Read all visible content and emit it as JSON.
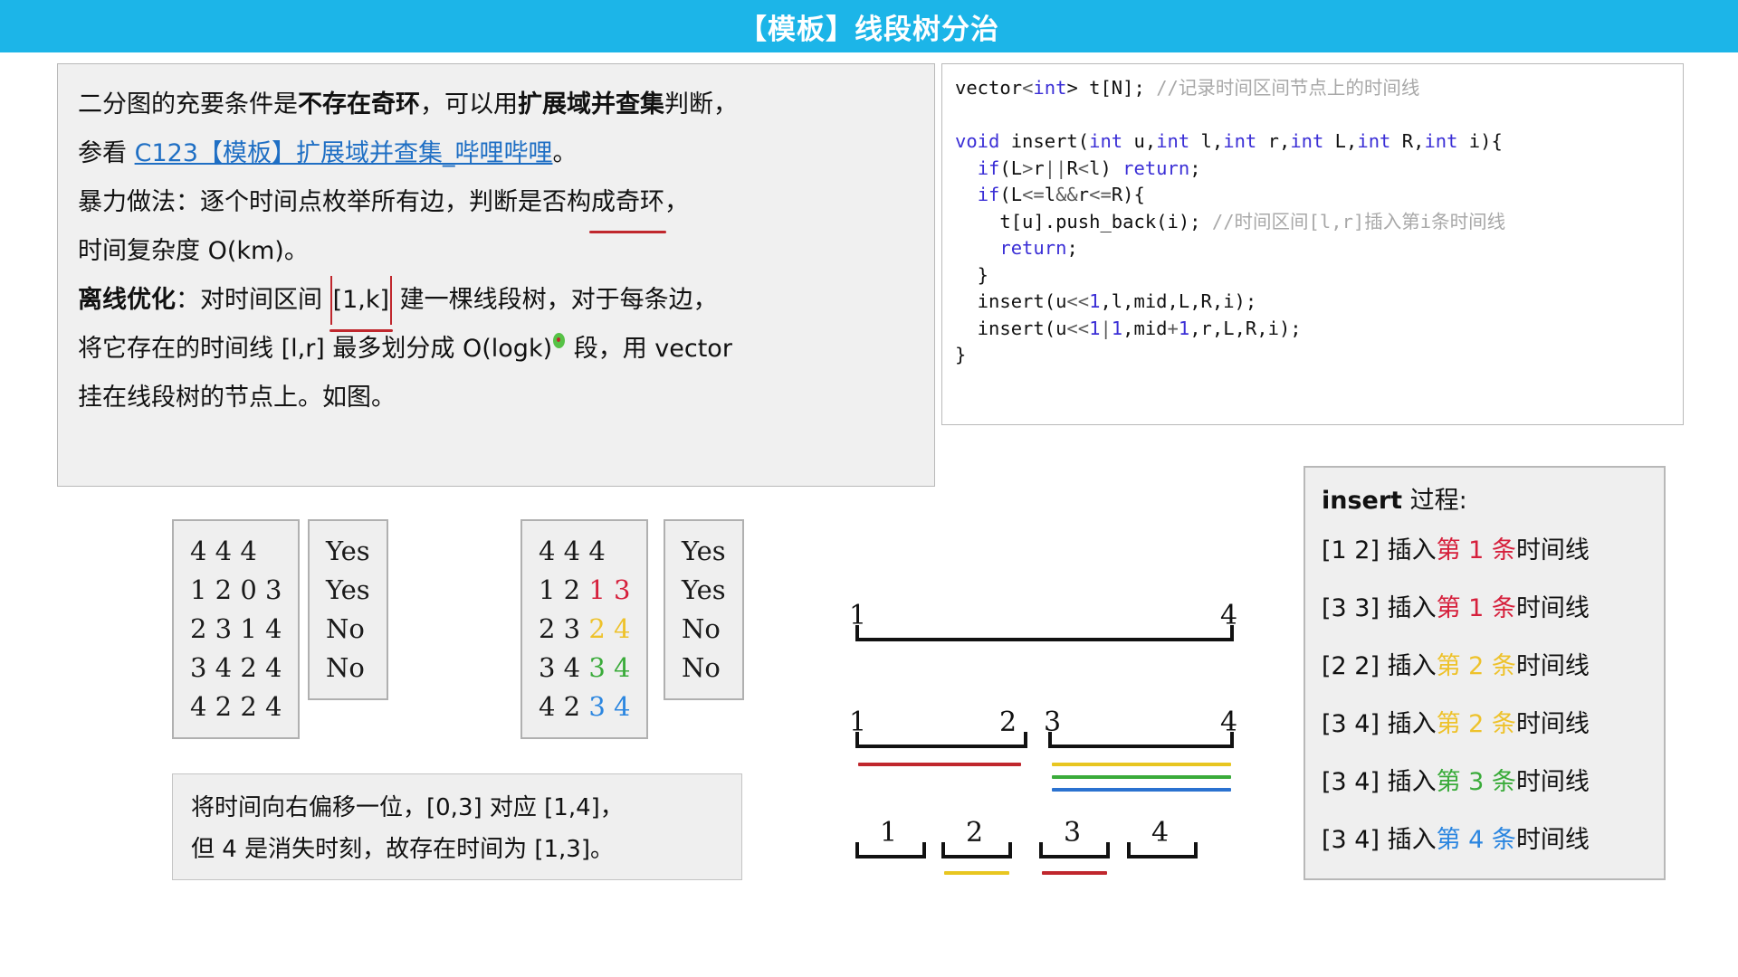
{
  "header": {
    "title": "【模板】线段树分治"
  },
  "prose": {
    "line1_a": "二分图的充要条件是",
    "line1_b": "不存在奇环",
    "line1_c": "，可以用",
    "line1_d": "扩展域并查集",
    "line1_e": "判断，",
    "line2_a": "参看 ",
    "line2_link": "C123【模板】扩展域并查集_哔哩哔哩",
    "line2_b": "。",
    "line3_a": "暴力做法：逐个时间点枚举所有边，判断是否构",
    "line3_mark": "成奇环",
    "line3_b": "，",
    "line4": "时间复杂度 O(km)。",
    "line5_a": "离线优化",
    "line5_b": "：对时间区间 ",
    "line5_mark": "[1,k]",
    "line5_c": " 建一棵线段树，对于每条边，",
    "line6_a": "将它存在的时间线 [l,r] 最多划分成 O(logk)",
    "line6_b": " 段，用 vector",
    "line7": "挂在线段树的节点上。如图。"
  },
  "code": {
    "lines": [
      [
        {
          "t": "vector",
          "c": "plain"
        },
        {
          "t": "<",
          "c": "op"
        },
        {
          "t": "int",
          "c": "kw"
        },
        {
          "t": "> t[N]; ",
          "c": "plain"
        },
        {
          "t": "//记录时间区间节点上的时间线",
          "c": "cm"
        }
      ],
      [
        {
          "t": "",
          "c": "plain"
        }
      ],
      [
        {
          "t": "void",
          "c": "kw"
        },
        {
          "t": " insert(",
          "c": "plain"
        },
        {
          "t": "int",
          "c": "kw"
        },
        {
          "t": " u,",
          "c": "plain"
        },
        {
          "t": "int",
          "c": "kw"
        },
        {
          "t": " l,",
          "c": "plain"
        },
        {
          "t": "int",
          "c": "kw"
        },
        {
          "t": " r,",
          "c": "plain"
        },
        {
          "t": "int",
          "c": "kw"
        },
        {
          "t": " L,",
          "c": "plain"
        },
        {
          "t": "int",
          "c": "kw"
        },
        {
          "t": " R,",
          "c": "plain"
        },
        {
          "t": "int",
          "c": "kw"
        },
        {
          "t": " i){",
          "c": "plain"
        }
      ],
      [
        {
          "t": "  ",
          "c": "plain"
        },
        {
          "t": "if",
          "c": "kw"
        },
        {
          "t": "(L",
          "c": "plain"
        },
        {
          "t": ">",
          "c": "op"
        },
        {
          "t": "r",
          "c": "plain"
        },
        {
          "t": "||",
          "c": "op"
        },
        {
          "t": "R",
          "c": "plain"
        },
        {
          "t": "<",
          "c": "op"
        },
        {
          "t": "l) ",
          "c": "plain"
        },
        {
          "t": "return",
          "c": "kw"
        },
        {
          "t": ";",
          "c": "plain"
        }
      ],
      [
        {
          "t": "  ",
          "c": "plain"
        },
        {
          "t": "if",
          "c": "kw"
        },
        {
          "t": "(L",
          "c": "plain"
        },
        {
          "t": "<=",
          "c": "op"
        },
        {
          "t": "l",
          "c": "plain"
        },
        {
          "t": "&&",
          "c": "op"
        },
        {
          "t": "r",
          "c": "plain"
        },
        {
          "t": "<=",
          "c": "op"
        },
        {
          "t": "R){",
          "c": "plain"
        }
      ],
      [
        {
          "t": "    t[u].push_back(i); ",
          "c": "plain"
        },
        {
          "t": "//时间区间[l,r]插入第i条时间线",
          "c": "cm"
        }
      ],
      [
        {
          "t": "    ",
          "c": "plain"
        },
        {
          "t": "return",
          "c": "kw"
        },
        {
          "t": ";",
          "c": "plain"
        }
      ],
      [
        {
          "t": "  }",
          "c": "plain"
        }
      ],
      [
        {
          "t": "  insert(u",
          "c": "plain"
        },
        {
          "t": "<<",
          "c": "op"
        },
        {
          "t": "1",
          "c": "kw"
        },
        {
          "t": ",l,mid,L,R,i);",
          "c": "plain"
        }
      ],
      [
        {
          "t": "  insert(u",
          "c": "plain"
        },
        {
          "t": "<<",
          "c": "op"
        },
        {
          "t": "1",
          "c": "kw"
        },
        {
          "t": "|",
          "c": "op"
        },
        {
          "t": "1",
          "c": "kw"
        },
        {
          "t": ",mid",
          "c": "plain"
        },
        {
          "t": "+",
          "c": "op"
        },
        {
          "t": "1",
          "c": "kw"
        },
        {
          "t": ",r,L,R,i);",
          "c": "plain"
        }
      ],
      [
        {
          "t": "}",
          "c": "plain"
        }
      ]
    ]
  },
  "samples": {
    "input1_rows": [
      "4 4 4",
      "1 2 0 3",
      "2 3 1 4",
      "3 4 2 4",
      "4 2 2 4"
    ],
    "output1_rows": [
      "Yes",
      "Yes",
      "No",
      "No"
    ],
    "input2_rows": [
      {
        "plain": "4 4 4",
        "tail": "",
        "color": ""
      },
      {
        "plain": "1 2 ",
        "tail": "1 3",
        "color": "c-red"
      },
      {
        "plain": "2 3 ",
        "tail": "2 4",
        "color": "c-yel"
      },
      {
        "plain": "3 4 ",
        "tail": "3 4",
        "color": "c-grn"
      },
      {
        "plain": "4 2 ",
        "tail": "3 4",
        "color": "c-blu"
      }
    ],
    "output2_rows": [
      "Yes",
      "Yes",
      "No",
      "No"
    ]
  },
  "shift_note": {
    "line1": "将时间向右偏移一位，[0,3] 对应 [1,4]，",
    "line2": "但 4 是消失时刻，故存在时间为 [1,3]。"
  },
  "diagram": {
    "root_left_label": "1",
    "root_right_label": "4",
    "mid_labels": [
      "1",
      "2",
      "3",
      "4"
    ],
    "leaf_labels": [
      "1",
      "2",
      "3",
      "4"
    ],
    "colors": {
      "red": "#c0272d",
      "yellow": "#e8c620",
      "green": "#3aab3a",
      "blue": "#2b72d0"
    }
  },
  "insert_process": {
    "title_bold": "insert",
    "title_rest": " 过程:",
    "rows": [
      {
        "range": "[1 2] ",
        "verb": "插入",
        "hl": "第 1 条",
        "tail": "时间线",
        "color": "c-red"
      },
      {
        "range": "[3 3] ",
        "verb": "插入",
        "hl": "第 1 条",
        "tail": "时间线",
        "color": "c-red"
      },
      {
        "range": "[2 2] ",
        "verb": "插入",
        "hl": "第 2 条",
        "tail": "时间线",
        "color": "c-yel"
      },
      {
        "range": "[3 4] ",
        "verb": "插入",
        "hl": "第 2 条",
        "tail": "时间线",
        "color": "c-yel"
      },
      {
        "range": "[3 4] ",
        "verb": "插入",
        "hl": "第 3 条",
        "tail": "时间线",
        "color": "c-grn"
      },
      {
        "range": "[3 4] ",
        "verb": "插入",
        "hl": "第 4 条",
        "tail": "时间线",
        "color": "c-blu"
      }
    ]
  },
  "colors": {
    "header_bg": "#1cb5e8",
    "panel_bg": "#efefef",
    "link": "#1f6fc4",
    "annotation_red": "#c0272d"
  }
}
